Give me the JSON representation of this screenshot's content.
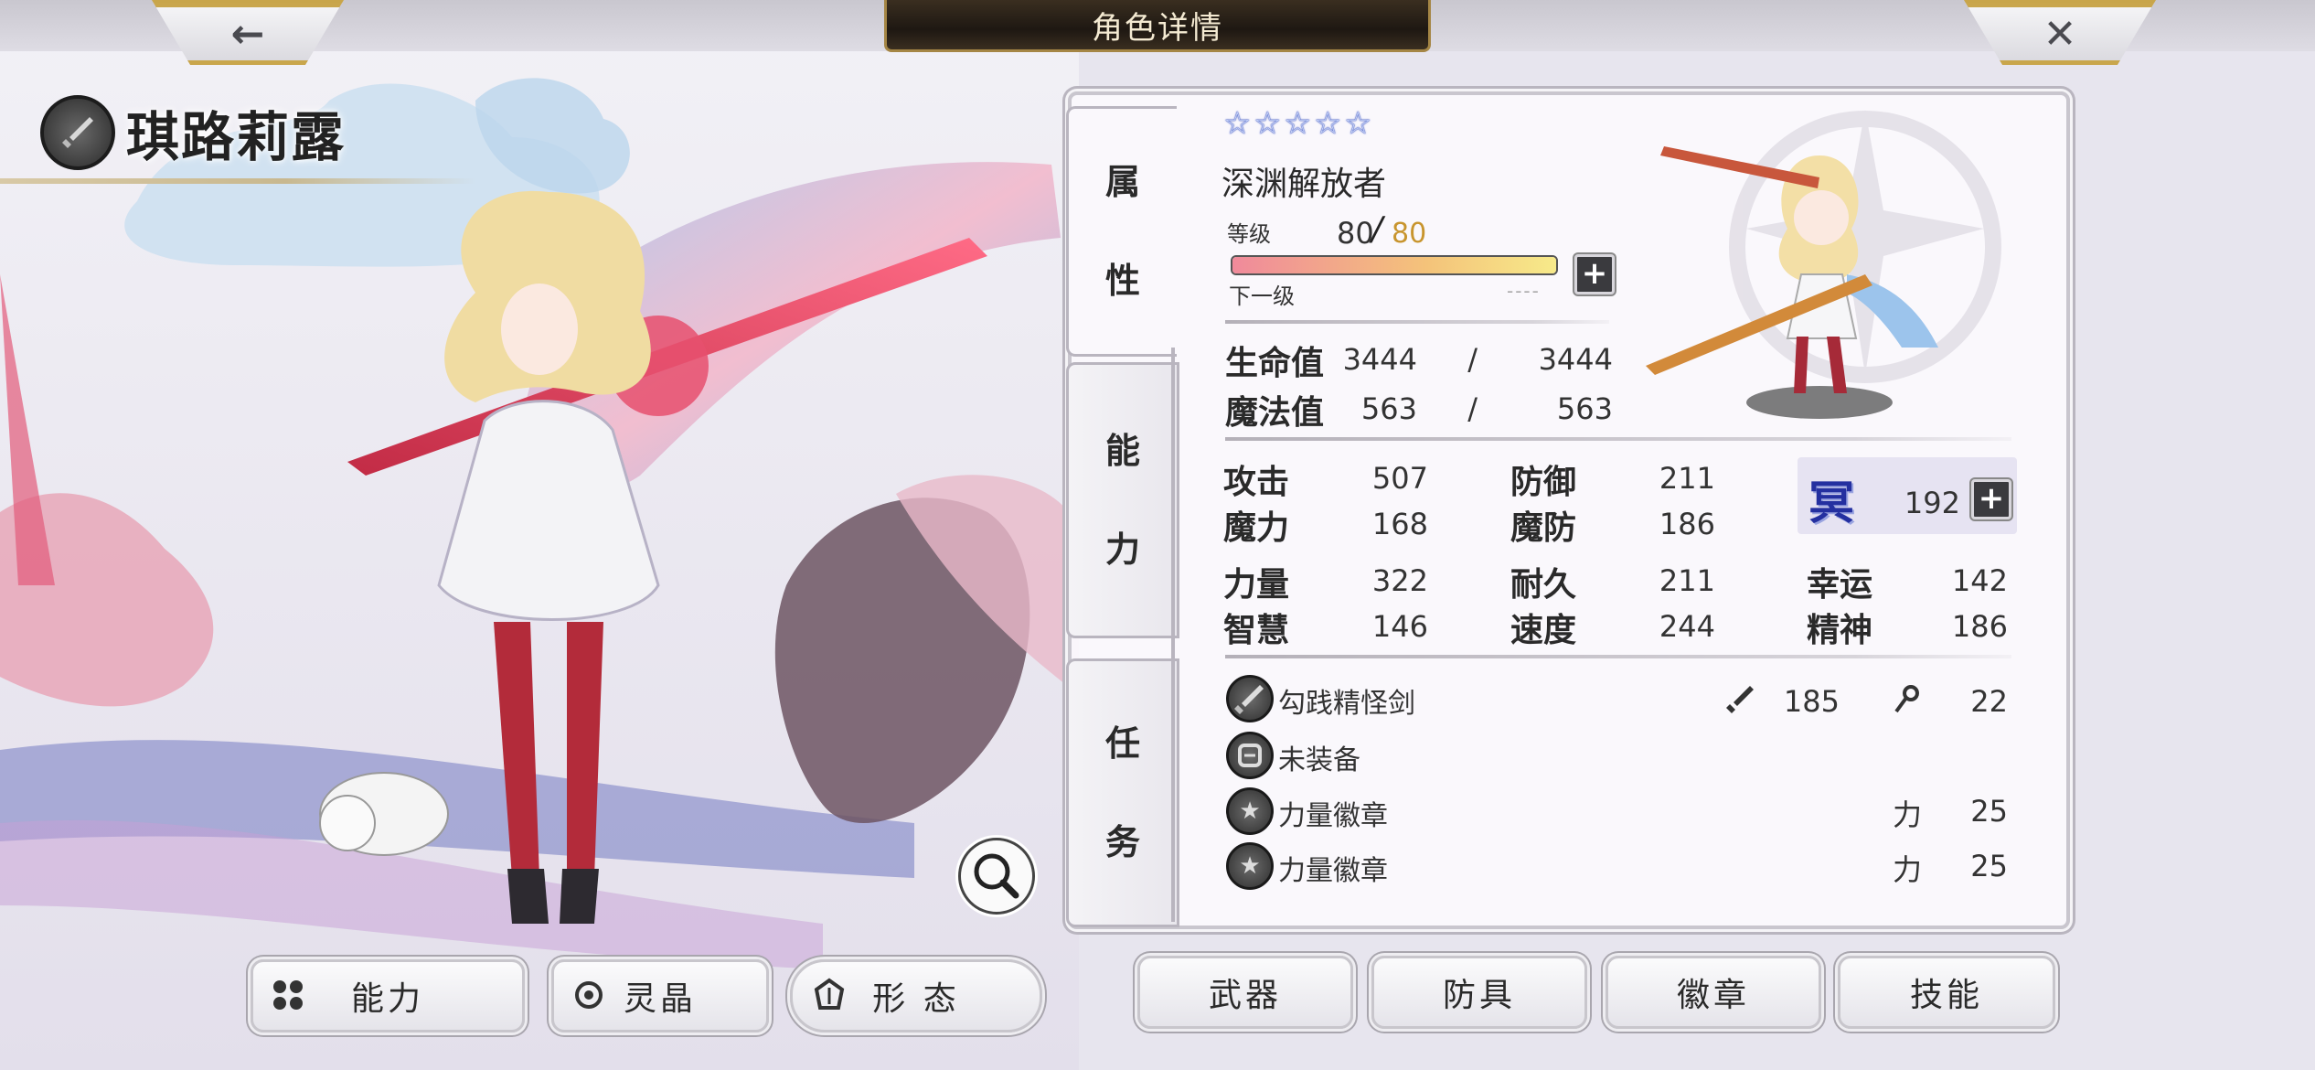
{
  "header": {
    "title": "角色详情",
    "back_icon": "←",
    "close_icon": "✕"
  },
  "character": {
    "name": "琪路莉露",
    "weapon_type_icon": "sword-icon"
  },
  "side_tabs": [
    {
      "label_top": "属",
      "label_bottom": "性"
    },
    {
      "label_top": "能",
      "label_bottom": "力"
    },
    {
      "label_top": "任",
      "label_bottom": "务"
    }
  ],
  "profile": {
    "stars": 5,
    "star_glyph": "☆",
    "job": "深渊解放者",
    "level_label": "等级",
    "level": "80",
    "level_sep": "/",
    "level_max": "80",
    "next_label": "下一级",
    "next_value": "----",
    "xp_progress": 1.0,
    "plus": "+"
  },
  "vitals": [
    {
      "label": "生命值",
      "current": "3444",
      "sep": "/",
      "max": "3444"
    },
    {
      "label": "魔法值",
      "current": "563",
      "sep": "/",
      "max": "563"
    }
  ],
  "stats": {
    "attack": {
      "label": "攻击",
      "value": "507"
    },
    "defense": {
      "label": "防御",
      "value": "211"
    },
    "magic": {
      "label": "魔力",
      "value": "168"
    },
    "magic_def": {
      "label": "魔防",
      "value": "186"
    },
    "strength": {
      "label": "力量",
      "value": "322"
    },
    "endurance": {
      "label": "耐久",
      "value": "211"
    },
    "luck": {
      "label": "幸运",
      "value": "142"
    },
    "wisdom": {
      "label": "智慧",
      "value": "146"
    },
    "speed": {
      "label": "速度",
      "value": "244"
    },
    "spirit": {
      "label": "精神",
      "value": "186"
    },
    "special": {
      "glyph": "冥",
      "value": "192"
    }
  },
  "equipment": [
    {
      "name": "勾践精怪剑",
      "icon": "sword-icon",
      "atk_icon": "sword-icon",
      "atk": "185",
      "mag_icon": "staff-icon",
      "mag": "22"
    },
    {
      "name": "未装备",
      "icon": "armor-icon"
    },
    {
      "name": "力量徽章",
      "icon": "star-badge-icon",
      "stat": "力",
      "value": "25"
    },
    {
      "name": "力量徽章",
      "icon": "star-badge-icon",
      "stat": "力",
      "value": "25"
    }
  ],
  "bottom_left_buttons": [
    {
      "label": "能力",
      "icon": "grid-icon"
    },
    {
      "label": "灵晶",
      "icon": "gear-icon"
    },
    {
      "label": "形 态",
      "icon": "form-icon"
    }
  ],
  "bottom_right_buttons": [
    {
      "label": "武器"
    },
    {
      "label": "防具"
    },
    {
      "label": "徽章"
    },
    {
      "label": "技能"
    }
  ],
  "colors": {
    "title_plate": "#1e1812",
    "gold_trim": "#c9a64c",
    "level_max_color": "#c8952e",
    "special_glyph": "#2430a0"
  }
}
